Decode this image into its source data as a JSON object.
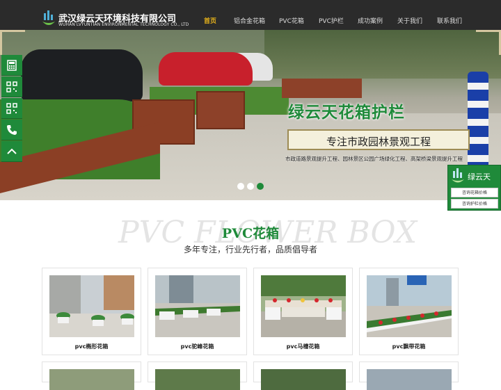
{
  "header": {
    "company_name": "武汉绿云天环境科技有限公司",
    "company_name_en": "WUHAN LVYUNTIAN ENVIRONMENTAL TECHNOLOGY CO., LTD",
    "nav": [
      {
        "label": "首页",
        "active": true
      },
      {
        "label": "铝合金花箱",
        "active": false
      },
      {
        "label": "PVC花箱",
        "active": false
      },
      {
        "label": "PVC护栏",
        "active": false
      },
      {
        "label": "成功案例",
        "active": false
      },
      {
        "label": "关于我们",
        "active": false
      },
      {
        "label": "联系我们",
        "active": false
      }
    ]
  },
  "banner": {
    "headline": "绿云天花箱护栏",
    "subhead": "专注市政园林景观工程",
    "tagline": "市政道路景观提升工程、园林景区公园广场绿化工程、高架桥梁景观提升工程",
    "slides": 3,
    "active_slide": 3
  },
  "left_float": {
    "icons": [
      "calculator-icon",
      "qrcode-icon",
      "qrcode-icon",
      "phone-icon",
      "chevron-up-icon"
    ]
  },
  "right_float": {
    "title": "绿云天",
    "buttons": [
      "咨询花箱价格",
      "咨询护栏价格"
    ]
  },
  "section": {
    "bg_text": "PVC FLOWER BOX",
    "title": "PVC花箱",
    "subtitle": "多年专注，行业先行者，品质倡导者"
  },
  "products": [
    {
      "caption": "pvc椭形花箱"
    },
    {
      "caption": "pvc驼峰花箱"
    },
    {
      "caption": "pvc马槽花箱"
    },
    {
      "caption": "pvc飘带花箱"
    }
  ],
  "colors": {
    "brand_green": "#1f8a3a",
    "header_bg": "#2b2b2b",
    "nav_active": "#e6b21b"
  }
}
